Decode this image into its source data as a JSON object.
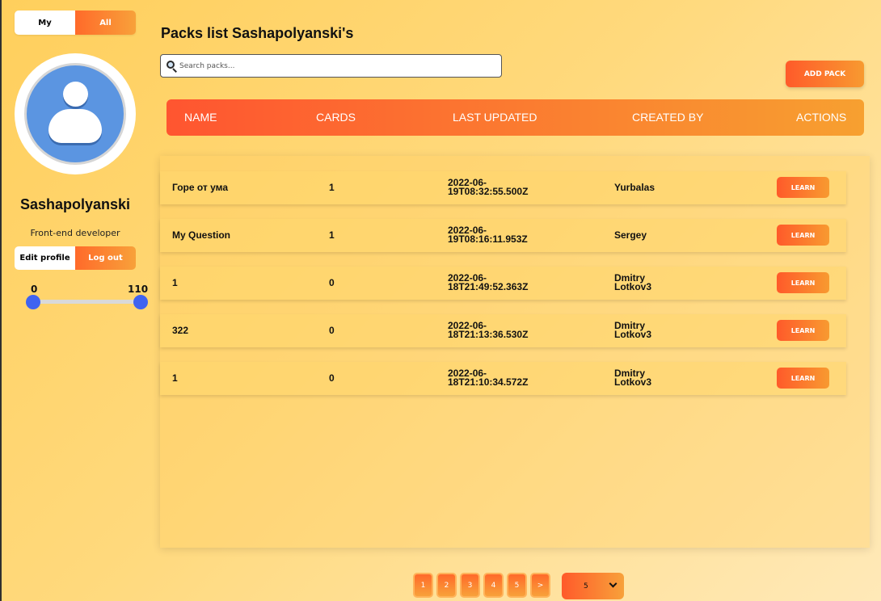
{
  "sidebar": {
    "toggle": {
      "my": "My",
      "all": "All"
    },
    "username": "Sashapolyanski",
    "role": "Front-end developer",
    "edit_profile": "Edit profile",
    "logout": "Log out",
    "range": {
      "min": "0",
      "max": "110"
    }
  },
  "main": {
    "title": "Packs list Sashapolyanski's",
    "search": {
      "placeholder": "Search packs..."
    },
    "add_pack": "ADD PACK",
    "columns": [
      "NAME",
      "CARDS",
      "LAST UPDATED",
      "CREATED BY",
      "ACTIONS"
    ],
    "rows": [
      {
        "name": "Горе от ума",
        "cards": "1",
        "updated_line1": "2022-06-",
        "updated_line2": "19T08:32:55.500Z",
        "created_line1": "Yurbalas",
        "created_line2": "",
        "action": "LEARN"
      },
      {
        "name": "My Question",
        "cards": "1",
        "updated_line1": "2022-06-",
        "updated_line2": "19T08:16:11.953Z",
        "created_line1": "Sergey",
        "created_line2": "",
        "action": "LEARN"
      },
      {
        "name": "1",
        "cards": "0",
        "updated_line1": "2022-06-",
        "updated_line2": "18T21:49:52.363Z",
        "created_line1": "Dmitry",
        "created_line2": "Lotkov3",
        "action": "LEARN"
      },
      {
        "name": "322",
        "cards": "0",
        "updated_line1": "2022-06-",
        "updated_line2": "18T21:13:36.530Z",
        "created_line1": "Dmitry",
        "created_line2": "Lotkov3",
        "action": "LEARN"
      },
      {
        "name": "1",
        "cards": "0",
        "updated_line1": "2022-06-",
        "updated_line2": "18T21:10:34.572Z",
        "created_line1": "Dmitry",
        "created_line2": "Lotkov3",
        "action": "LEARN"
      }
    ]
  },
  "pagination": {
    "pages": [
      "1",
      "2",
      "3",
      "4",
      "5"
    ],
    "next": ">",
    "page_size": "5"
  },
  "colors": {
    "accent_start": "#ff5a2a",
    "accent_end": "#f89a30",
    "slider_thumb": "#3f63f0",
    "avatar_bg": "#5b95e1"
  }
}
